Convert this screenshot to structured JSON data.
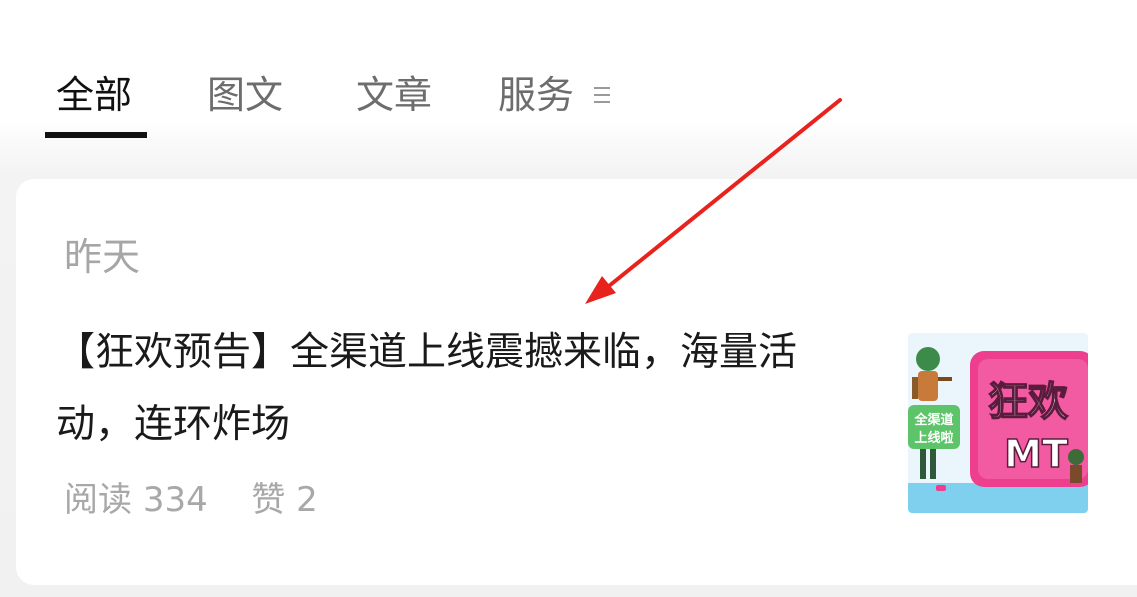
{
  "tabs": {
    "items": [
      {
        "label": "全部",
        "active": true
      },
      {
        "label": "图文",
        "active": false
      },
      {
        "label": "文章",
        "active": false
      },
      {
        "label": "服务",
        "active": false
      }
    ],
    "menu_icon": "menu-lines-icon"
  },
  "article": {
    "date": "昨天",
    "title": "【狂欢预告】全渠道上线震撼来临，海量活动，连环炸场",
    "reads_label": "阅读",
    "reads": "334",
    "likes_label": "赞",
    "likes": "2",
    "thumbnail": {
      "text_main": "狂欢",
      "text_sub": "MT",
      "badge_line1": "全渠道",
      "badge_line2": "上线啦"
    }
  },
  "annotation": {
    "color": "#e8231e"
  }
}
